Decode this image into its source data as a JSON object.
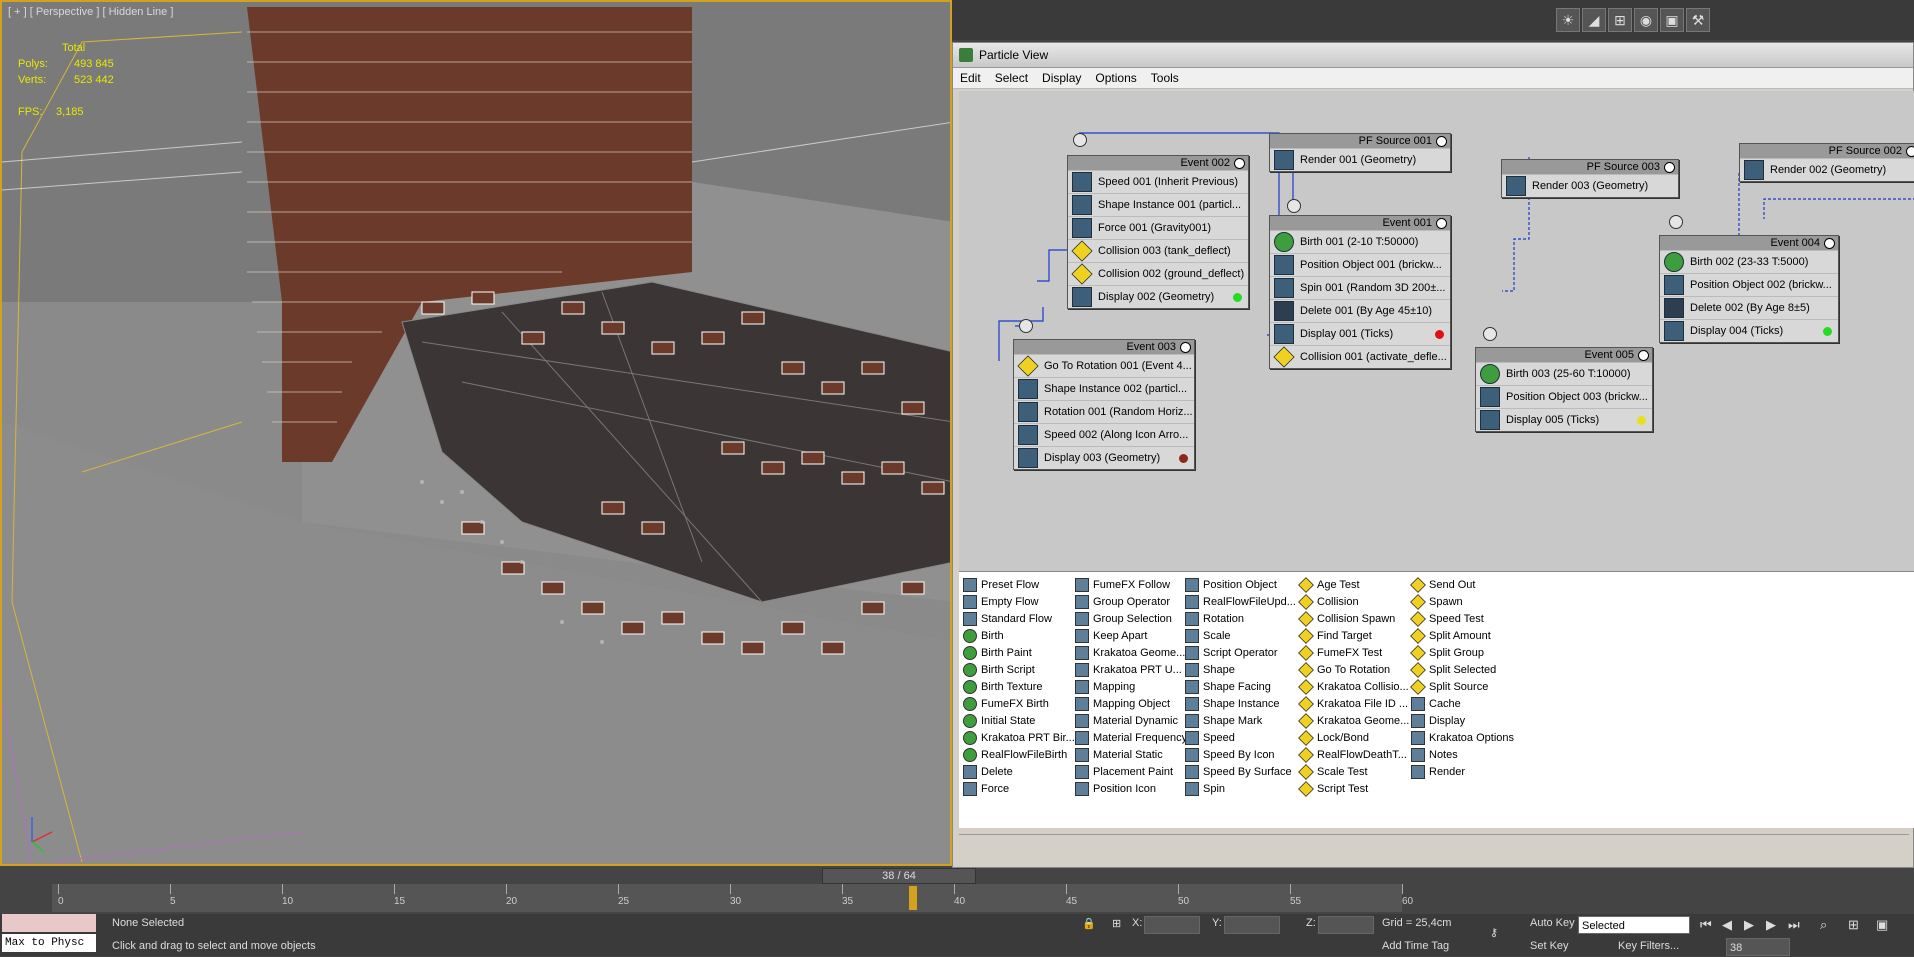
{
  "viewport": {
    "label": "[ + ] [ Perspective ] [ Hidden Line ]",
    "stats": {
      "total_label": "Total",
      "polys_label": "Polys:",
      "polys_value": "493 845",
      "verts_label": "Verts:",
      "verts_value": "523 442",
      "fps_label": "FPS:",
      "fps_value": "3,185"
    }
  },
  "particle_view": {
    "title": "Particle View",
    "menu": [
      "Edit",
      "Select",
      "Display",
      "Options",
      "Tools"
    ],
    "nodes": {
      "event002": {
        "title": "Event 002",
        "ops": [
          "Speed 001 (Inherit Previous)",
          "Shape Instance 001 (particl...",
          "Force 001 (Gravity001)",
          "Collision 003 (tank_deflect)",
          "Collision 002 (ground_deflect)",
          "Display 002 (Geometry)"
        ]
      },
      "event003": {
        "title": "Event 003",
        "ops": [
          "Go To Rotation 001 (Event 4...",
          "Shape Instance 002 (particl...",
          "Rotation 001 (Random Horiz...",
          "Speed 002 (Along Icon Arro...",
          "Display 003 (Geometry)"
        ]
      },
      "source001": {
        "title": "PF Source 001",
        "ops": [
          "Render 001 (Geometry)"
        ]
      },
      "event001": {
        "title": "Event 001",
        "ops": [
          "Birth 001 (2-10 T:50000)",
          "Position Object 001 (brickw...",
          "Spin 001 (Random 3D 200±...",
          "Delete 001 (By Age 45±10)",
          "Display 001 (Ticks)",
          "Collision 001 (activate_defle..."
        ]
      },
      "source003": {
        "title": "PF Source 003",
        "ops": [
          "Render 003 (Geometry)"
        ]
      },
      "source002": {
        "title": "PF Source 002",
        "ops": [
          "Render 002 (Geometry)"
        ]
      },
      "event004": {
        "title": "Event 004",
        "ops": [
          "Birth 002 (23-33 T:5000)",
          "Position Object 002 (brickw...",
          "Delete 002 (By Age 8±5)",
          "Display 004 (Ticks)"
        ]
      },
      "event005": {
        "title": "Event 005",
        "ops": [
          "Birth 003 (25-60 T:10000)",
          "Position Object 003 (brickw...",
          "Display 005 (Ticks)"
        ]
      }
    },
    "colors": {
      "display002": "#22dd22",
      "display003": "#8b2a1a",
      "display001": "#e01010",
      "display004": "#22dd22",
      "display005": "#e8e020"
    },
    "depot": {
      "col1": [
        "Preset Flow",
        "Empty Flow",
        "Standard Flow",
        "Birth",
        "Birth Paint",
        "Birth Script",
        "Birth Texture",
        "FumeFX Birth",
        "Initial State",
        "Krakatoa PRT Bir...",
        "RealFlowFileBirth",
        "Delete",
        "Force"
      ],
      "col2": [
        "FumeFX Follow",
        "Group Operator",
        "Group Selection",
        "Keep Apart",
        "Krakatoa Geome...",
        "Krakatoa PRT U...",
        "Mapping",
        "Mapping Object",
        "Material Dynamic",
        "Material Frequency",
        "Material Static",
        "Placement Paint",
        "Position Icon"
      ],
      "col3": [
        "Position Object",
        "RealFlowFileUpd...",
        "Rotation",
        "Scale",
        "Script Operator",
        "Shape",
        "Shape Facing",
        "Shape Instance",
        "Shape Mark",
        "Speed",
        "Speed By Icon",
        "Speed By Surface",
        "Spin"
      ],
      "col4": [
        "Age Test",
        "Collision",
        "Collision Spawn",
        "Find Target",
        "FumeFX Test",
        "Go To Rotation",
        "Krakatoa Collisio...",
        "Krakatoa File ID ...",
        "Krakatoa Geome...",
        "Lock/Bond",
        "RealFlowDeathT...",
        "Scale Test",
        "Script Test"
      ],
      "col5": [
        "Send Out",
        "Spawn",
        "Speed Test",
        "Split Amount",
        "Split Group",
        "Split Selected",
        "Split Source",
        "Cache",
        "Display",
        "Krakatoa Options",
        "Notes",
        "Render"
      ]
    }
  },
  "timeline": {
    "frame_display": "38 / 64",
    "ticks": [
      "0",
      "5",
      "10",
      "15",
      "20",
      "25",
      "30",
      "35",
      "40",
      "45",
      "50",
      "55",
      "60"
    ],
    "current_frame": 38,
    "total_frames": 64
  },
  "status": {
    "maxscript_value": "Max to Physc",
    "selection": "None Selected",
    "prompt": "Click and drag to select and move objects",
    "x_label": "X:",
    "y_label": "Y:",
    "z_label": "Z:",
    "grid": "Grid = 25,4cm",
    "add_time_tag": "Add Time Tag",
    "auto_key": "Auto Key",
    "set_key": "Set Key",
    "selected_dropdown": "Selected",
    "key_filters": "Key Filters...",
    "frame_field": "38"
  }
}
